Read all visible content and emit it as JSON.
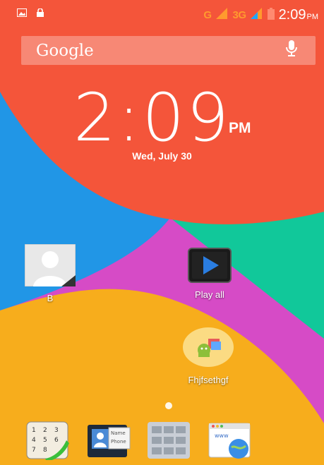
{
  "status_bar": {
    "network": "G",
    "network_type": "3G",
    "time": "2:09",
    "ampm": "PM"
  },
  "search_widget": {
    "logo": "Google",
    "icon": "mic-icon"
  },
  "clock_widget": {
    "time": "2:09",
    "ampm": "PM",
    "date": "Wed, July 30"
  },
  "apps": [
    {
      "label": "B",
      "icon": "contact-icon"
    },
    {
      "label": "Play all",
      "icon": "play-icon"
    },
    {
      "label": "Fhjfsethgf",
      "icon": "android-folder-icon"
    }
  ],
  "dock": [
    {
      "icon": "phone-dialer-icon"
    },
    {
      "icon": "contacts-card-icon",
      "card_name": "Name",
      "card_phone": "Phone"
    },
    {
      "icon": "app-drawer-icon"
    },
    {
      "icon": "browser-icon",
      "text": "www"
    }
  ],
  "colors": {
    "red": "#f4553a",
    "blue": "#2196e6",
    "green": "#11c89a",
    "magenta": "#d64bc6",
    "yellow": "#f7ad1c"
  }
}
